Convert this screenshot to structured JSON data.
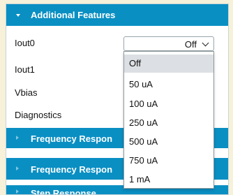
{
  "section": {
    "title": "Additional Features"
  },
  "rows": [
    {
      "label": "Iout0"
    },
    {
      "label": "Iout1"
    },
    {
      "label": "Vbias"
    },
    {
      "label": "Diagnostics"
    }
  ],
  "iout0_select": {
    "value": "Off",
    "options": [
      "Off",
      "50 uA",
      "100 uA",
      "250 uA",
      "500 uA",
      "750 uA",
      "1 mA"
    ]
  },
  "collapsed_sections": [
    {
      "title": "Frequency Respon"
    },
    {
      "title": "Frequency Respon"
    },
    {
      "title": "Step Response"
    }
  ],
  "colors": {
    "header_bg": "#0a8fc3",
    "page_bg": "#f6f1d8",
    "selected_option_bg": "#dcdfe3"
  }
}
